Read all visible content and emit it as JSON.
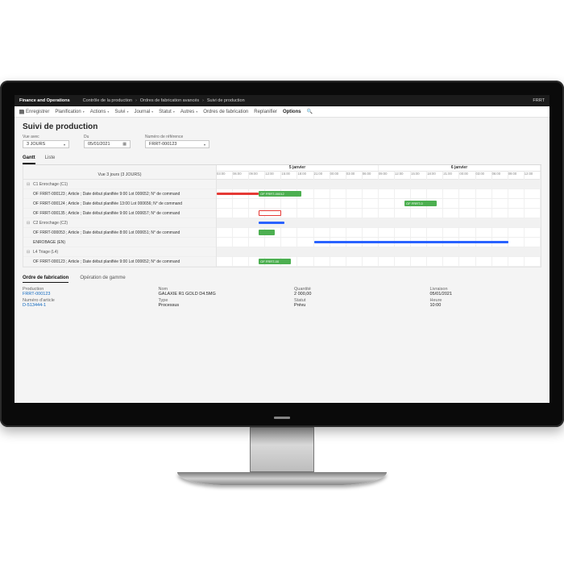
{
  "topbar": {
    "brand": "Finance and Operations",
    "crumbs": [
      "Contrôle de la production",
      "Ordres de fabrication avancés",
      "Suivi de production"
    ],
    "company": "FRRT"
  },
  "ribbon": {
    "save": "Enregistrer",
    "items": [
      "Planification",
      "Actions",
      "Suivi",
      "Journal",
      "Statut",
      "Autres",
      "Ordres de fabrication",
      "Replanifier"
    ],
    "options": "Options"
  },
  "page": {
    "title": "Suivi de production",
    "filters": {
      "view_label": "Vue avec",
      "view_value": "3 JOURS",
      "from_label": "Du",
      "from_value": "05/01/2021",
      "ref_label": "Numéro de référence",
      "ref_value": "FRRT-000123"
    },
    "tabs": {
      "gantt": "Gantt",
      "liste": "Liste"
    }
  },
  "gantt": {
    "left_header": "Vue 3 jours (3 JOURS)",
    "days": [
      "5 janvier",
      "6 janvier"
    ],
    "hours": [
      "03:00",
      "06:00",
      "09:00",
      "12:00",
      "15:00",
      "18:00",
      "21:00",
      "00:00",
      "03:00",
      "06:00",
      "09:00",
      "12:00",
      "15:00",
      "18:00",
      "21:00",
      "00:00",
      "03:00",
      "06:00",
      "09:00",
      "12:00"
    ],
    "rows": [
      {
        "type": "group",
        "label": "C1 Enrochage (C1)"
      },
      {
        "type": "child",
        "label": "OF FRRT-000123 ; Article ; Date début planifiée 9:00 Lot 000652; N° de command",
        "bars": [
          {
            "cls": "redline",
            "l": 0,
            "w": 13
          },
          {
            "cls": "green",
            "l": 13,
            "w": 13,
            "text": "OF FRRT-00012"
          }
        ]
      },
      {
        "type": "child",
        "label": "OF FRRT-000124 ; Article ; Date début planifiée 13:00 Lot 000656; N° de command",
        "bars": [
          {
            "cls": "green",
            "l": 58,
            "w": 10,
            "text": "OF FRRT-0"
          }
        ]
      },
      {
        "type": "child",
        "label": "OF FRRT-000135 ; Article ; Date début planifiée 9:00 Lot 000657; N° de command",
        "bars": [
          {
            "cls": "outlined",
            "l": 13,
            "w": 7
          }
        ]
      },
      {
        "type": "group",
        "label": "C2 Enrochage (C2)",
        "bars": [
          {
            "cls": "blueline",
            "l": 13,
            "w": 8
          }
        ]
      },
      {
        "type": "child",
        "label": "OF FRRT-000053 ; Article ; Date début planifiée 8:00 Lot 000651; N° de command",
        "bars": [
          {
            "cls": "green",
            "l": 13,
            "w": 5
          }
        ]
      },
      {
        "type": "child",
        "label": "ENROBAGE (EN)",
        "bars": [
          {
            "cls": "blueline",
            "l": 30,
            "w": 60
          }
        ]
      },
      {
        "type": "group",
        "label": "L4 Triage (L4)"
      },
      {
        "type": "child",
        "label": "OF FRRT-000123 ; Article ; Date début planifiée 9:00 Lot 000652; N° de command",
        "bars": [
          {
            "cls": "green",
            "l": 13,
            "w": 10,
            "text": "OF FRRT-00"
          }
        ]
      }
    ]
  },
  "detail": {
    "tabs": {
      "order": "Ordre de fabrication",
      "oper": "Opération de gamme"
    },
    "r1": {
      "k1": "Production",
      "v1": "FRRT-000123",
      "k2": "Nom",
      "v2": "GALAXIE R1 GOLD D4.5MG",
      "k3": "Quantité",
      "v3": "2 000,00",
      "k4": "Livraison",
      "v4": "05/01/2021"
    },
    "r2": {
      "k1": "Numéro d'article",
      "v1": "D-513444-1",
      "k2": "Type",
      "v2": "Processus",
      "k3": "Statut",
      "v3": "Prévu",
      "k4": "Heure",
      "v4": "10:00"
    }
  }
}
